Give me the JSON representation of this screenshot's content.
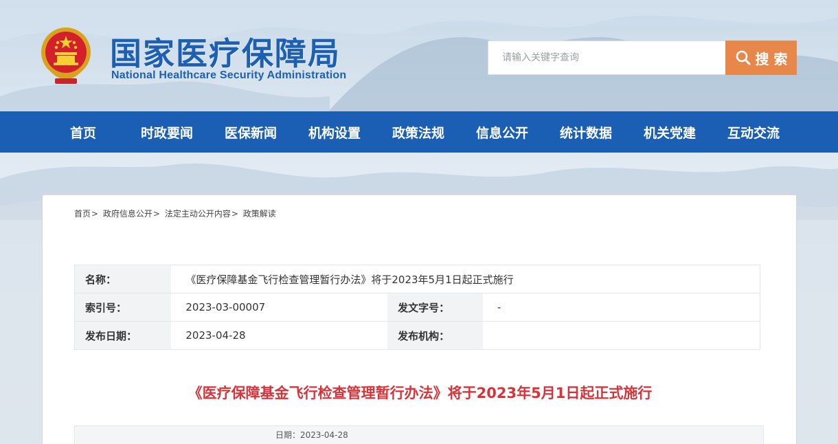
{
  "header": {
    "title_cn": "国家医疗保障局",
    "title_en": "National Healthcare Security Administration",
    "search": {
      "placeholder": "请输入关键字查询",
      "button_label": "搜 索"
    }
  },
  "colors": {
    "brand_blue": "#1a5fb4",
    "search_orange": "#e7884a",
    "title_red": "#d7343a"
  },
  "nav": {
    "items": [
      "首页",
      "时政要闻",
      "医保新闻",
      "机构设置",
      "政策法规",
      "信息公开",
      "统计数据",
      "机关党建",
      "互动交流"
    ]
  },
  "breadcrumb": {
    "items": [
      "首页",
      "政府信息公开",
      "法定主动公开内容",
      "政策解读"
    ],
    "separator": ">"
  },
  "info_table": {
    "name_label": "名称：",
    "name_value": "《医疗保障基金飞行检查管理暂行办法》将于2023年5月1日起正式施行",
    "index_label": "索引号：",
    "index_value": "2023-03-00007",
    "doc_no_label": "发文字号：",
    "doc_no_value": "-",
    "date_label": "发布日期：",
    "date_value": "2023-04-28",
    "org_label": "发布机构：",
    "org_value": ""
  },
  "article": {
    "title": "《医疗保障基金飞行检查管理暂行办法》将于2023年5月1日起正式施行",
    "date_line": "日期：2023-04-28"
  },
  "icons": {
    "emblem": "national-emblem-icon",
    "search": "magnifier-icon"
  }
}
